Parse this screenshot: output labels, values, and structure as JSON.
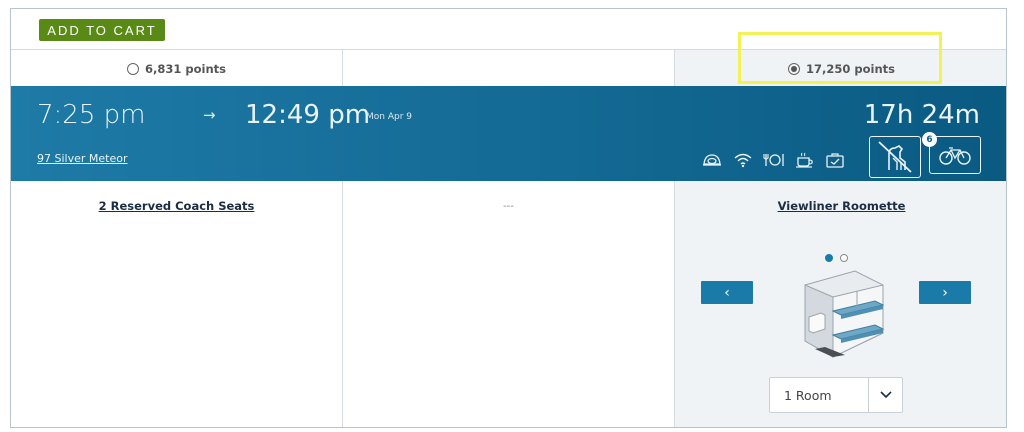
{
  "actions": {
    "add_to_cart": "ADD TO CART"
  },
  "prices": [
    {
      "label": "6,831 points",
      "selected": false
    },
    {
      "label": "",
      "selected": false
    },
    {
      "label": "17,250 points",
      "selected": true
    }
  ],
  "train": {
    "departure": "7:25 pm",
    "arrow": "→",
    "arrival": "12:49 pm",
    "arrival_date": "Mon Apr 9",
    "name": "97 Silver Meteor",
    "duration": "17h 24m",
    "amenities": [
      "seat-icon",
      "wifi-icon",
      "dining-icon",
      "cafe-icon",
      "checked-bag-icon"
    ],
    "pets_icon": "no-pets-icon",
    "bike_icon": "bike-icon",
    "bike_badge": "6"
  },
  "accommodations": [
    {
      "title": "2 Reserved Coach Seats"
    },
    {
      "title": "---"
    },
    {
      "title": "Viewliner Roomette",
      "slides": 2,
      "active_slide": 0,
      "prev": "‹",
      "next": "›",
      "quantity": "1 Room"
    }
  ],
  "colors": {
    "accent": "#1a7aa8",
    "cart_green": "#5a8a16",
    "highlight": "#f1f256",
    "train_bar": "#136a94"
  }
}
